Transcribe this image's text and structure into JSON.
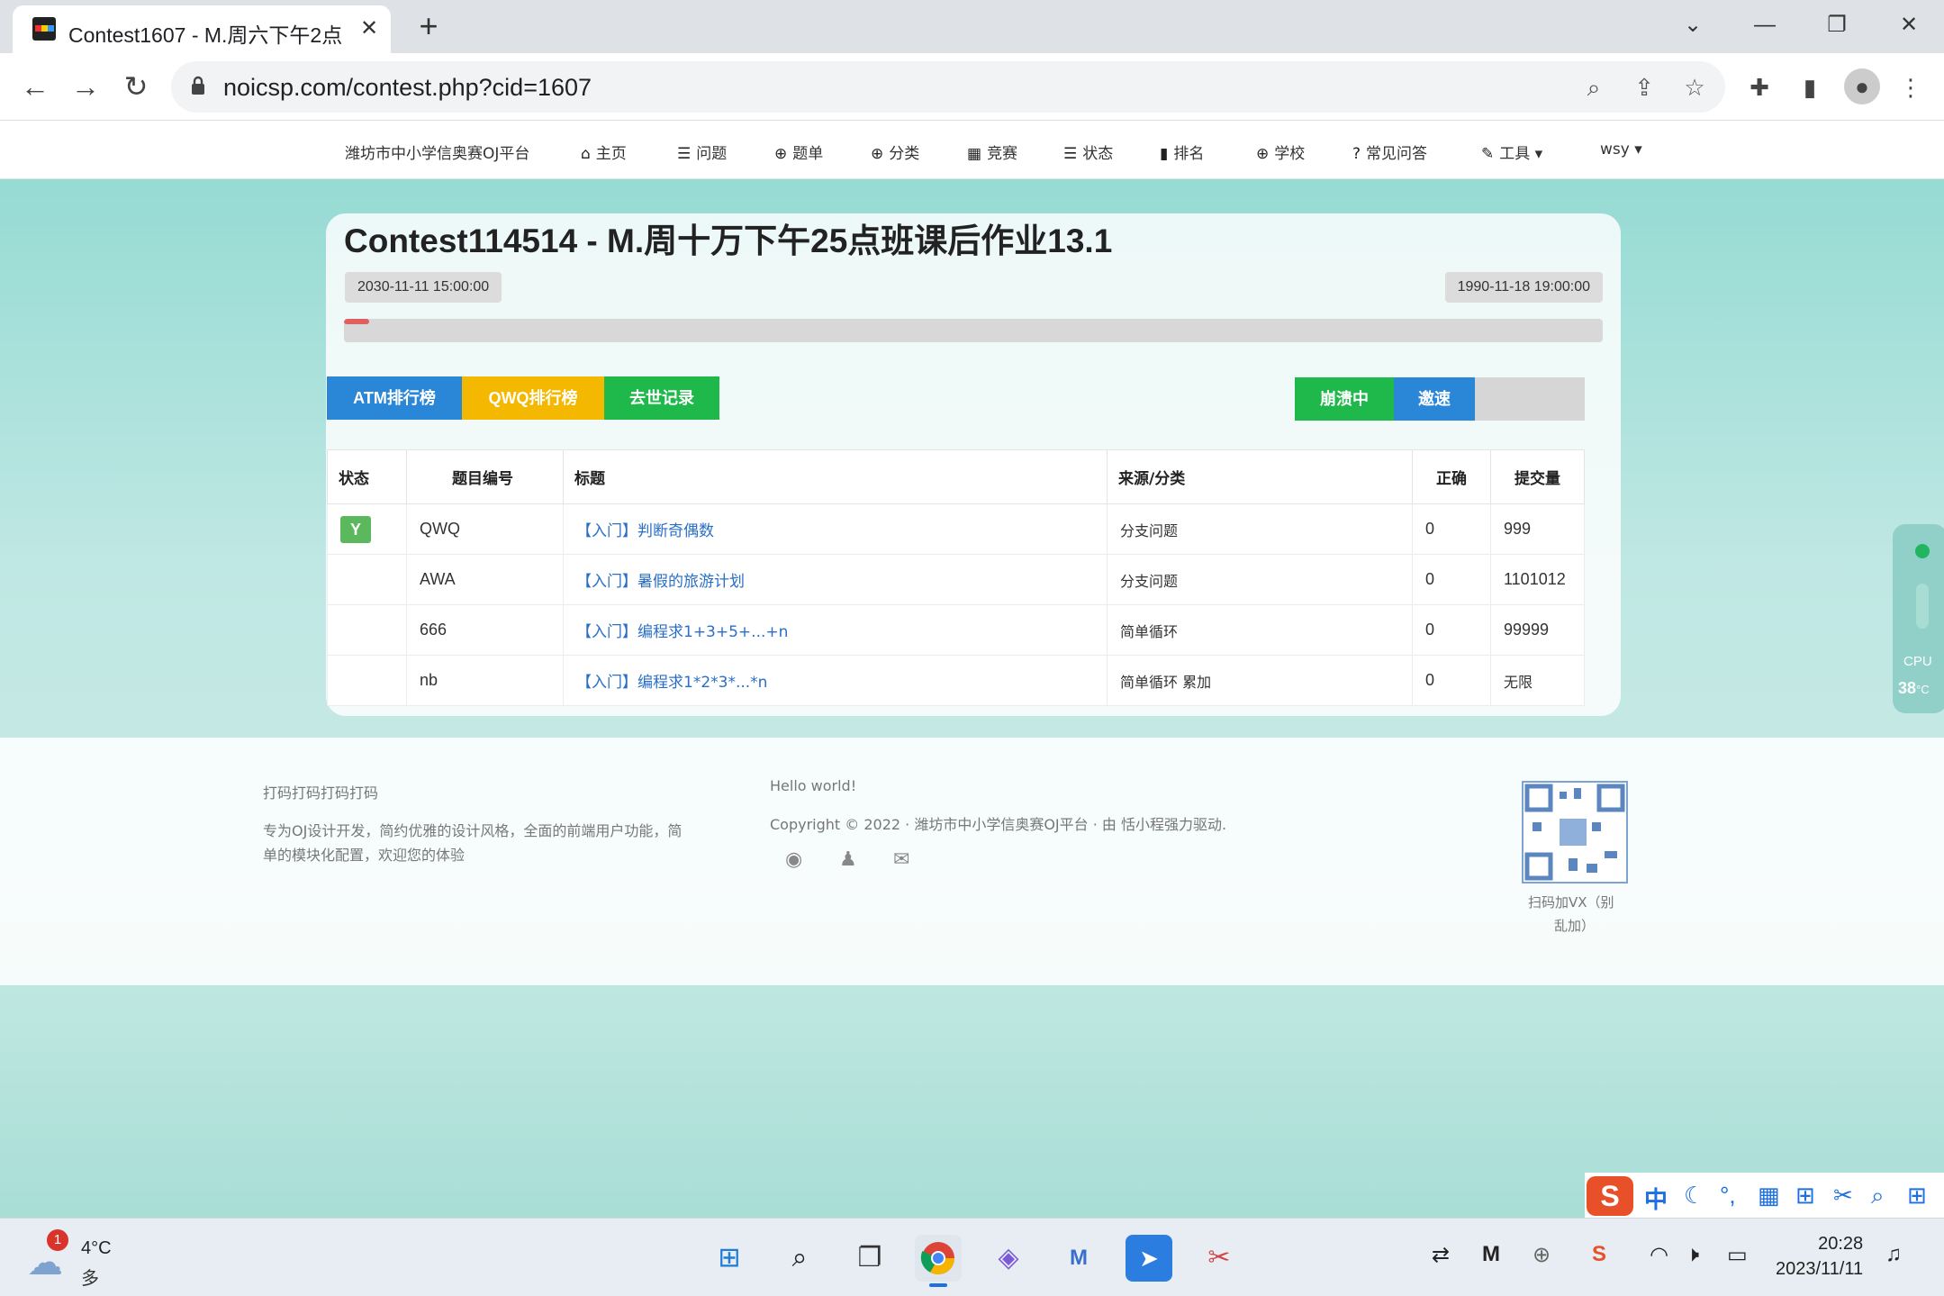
{
  "browser": {
    "tab_title": "Contest1607 - M.周六下午2点",
    "url": "noicsp.com/contest.php?cid=1607"
  },
  "site_nav": {
    "brand": "潍坊市中小学信奥赛OJ平台",
    "items": [
      {
        "icon": "home-icon",
        "glyph": "⌂",
        "label": "主页"
      },
      {
        "icon": "list-icon",
        "glyph": "☰",
        "label": "问题"
      },
      {
        "icon": "globe-icon",
        "glyph": "⊕",
        "label": "题单"
      },
      {
        "icon": "globe-icon",
        "glyph": "⊕",
        "label": "分类"
      },
      {
        "icon": "calendar-icon",
        "glyph": "▦",
        "label": "竞赛"
      },
      {
        "icon": "list-icon",
        "glyph": "☰",
        "label": "状态"
      },
      {
        "icon": "bar-chart-icon",
        "glyph": "▮",
        "label": "排名"
      },
      {
        "icon": "globe-icon",
        "glyph": "⊕",
        "label": "学校"
      },
      {
        "icon": "question-icon",
        "glyph": "?",
        "label": "常见问答"
      },
      {
        "icon": "wrench-icon",
        "glyph": "✎",
        "label": "工具 ▾"
      }
    ],
    "user": "wsy ▾"
  },
  "contest": {
    "title": "Contest114514 - M.周十万下午25点班课后作业13.1",
    "start_time": "2030-11-11 15:00:00",
    "end_time": "1990-11-18 19:00:00",
    "progress": 0.02,
    "rank_buttons": [
      {
        "label": "ATM排行榜",
        "color": "#2a86d6"
      },
      {
        "label": "QWQ排行榜",
        "color": "#f5b800"
      },
      {
        "label": "去世记录",
        "color": "#1fb84a"
      }
    ],
    "status_buttons": [
      {
        "label": "崩溃中",
        "color": "#1fb84a"
      },
      {
        "label": "邀速",
        "color": "#2a86d6"
      }
    ]
  },
  "problems": {
    "headers": [
      "状态",
      "题目编号",
      "标题",
      "来源/分类",
      "正确",
      "提交量"
    ],
    "rows": [
      {
        "status": "Y",
        "id": "QWQ",
        "title": "【入门】判断奇偶数",
        "source": "分支问题",
        "correct": "0",
        "submits": "999"
      },
      {
        "status": "",
        "id": "AWA",
        "title": "【入门】暑假的旅游计划",
        "source": "分支问题",
        "correct": "0",
        "submits": "1101012"
      },
      {
        "status": "",
        "id": "666",
        "title": "【入门】编程求1+3+5+...+n",
        "source": "简单循环",
        "correct": "0",
        "submits": "99999"
      },
      {
        "status": "",
        "id": "nb",
        "title": "【入门】编程求1*2*3*...*n",
        "source": "简单循环 累加",
        "correct": "0",
        "submits": "无限"
      }
    ]
  },
  "footer": {
    "left_title": "打码打码打码打码",
    "left_desc_1": "专为OJ设计开发，简约优雅的设计风格，全面的前端用户功能，简",
    "left_desc_2": "单的模块化配置，欢迎您的体验",
    "hello": "Hello world!",
    "copyright": "Copyright © 2022 · 潍坊市中小学信奥赛OJ平台 · 由 恬小程强力驱动.",
    "qr_caption_1": "扫码加VX（别",
    "qr_caption_2": "乱加）"
  },
  "cpu_widget": {
    "label": "CPU",
    "temp": "38",
    "unit": "°C"
  },
  "taskbar": {
    "weather_temp": "4°C",
    "weather_desc": "多云",
    "weather_badge": "1",
    "time": "20:28",
    "date": "2023/11/11"
  },
  "ime": {
    "mode": "中"
  }
}
